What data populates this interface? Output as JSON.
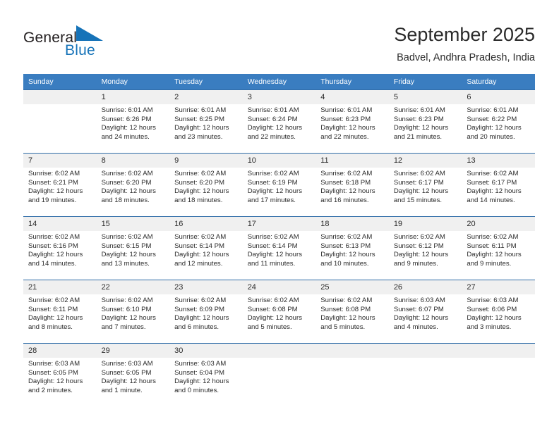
{
  "brand": {
    "name_part1": "General",
    "name_part2": "Blue",
    "triangle_color": "#1673b8"
  },
  "header": {
    "title": "September 2025",
    "subtitle": "Badvel, Andhra Pradesh, India"
  },
  "theme": {
    "header_bg": "#3a7dc0",
    "row_border": "#2f6ca8",
    "daynum_bg": "#f0f0f0",
    "text": "#2b2b2b"
  },
  "weekdays": [
    "Sunday",
    "Monday",
    "Tuesday",
    "Wednesday",
    "Thursday",
    "Friday",
    "Saturday"
  ],
  "weeks": [
    [
      {
        "day": "",
        "lines": []
      },
      {
        "day": "1",
        "lines": [
          "Sunrise: 6:01 AM",
          "Sunset: 6:26 PM",
          "Daylight: 12 hours",
          "and 24 minutes."
        ]
      },
      {
        "day": "2",
        "lines": [
          "Sunrise: 6:01 AM",
          "Sunset: 6:25 PM",
          "Daylight: 12 hours",
          "and 23 minutes."
        ]
      },
      {
        "day": "3",
        "lines": [
          "Sunrise: 6:01 AM",
          "Sunset: 6:24 PM",
          "Daylight: 12 hours",
          "and 22 minutes."
        ]
      },
      {
        "day": "4",
        "lines": [
          "Sunrise: 6:01 AM",
          "Sunset: 6:23 PM",
          "Daylight: 12 hours",
          "and 22 minutes."
        ]
      },
      {
        "day": "5",
        "lines": [
          "Sunrise: 6:01 AM",
          "Sunset: 6:23 PM",
          "Daylight: 12 hours",
          "and 21 minutes."
        ]
      },
      {
        "day": "6",
        "lines": [
          "Sunrise: 6:01 AM",
          "Sunset: 6:22 PM",
          "Daylight: 12 hours",
          "and 20 minutes."
        ]
      }
    ],
    [
      {
        "day": "7",
        "lines": [
          "Sunrise: 6:02 AM",
          "Sunset: 6:21 PM",
          "Daylight: 12 hours",
          "and 19 minutes."
        ]
      },
      {
        "day": "8",
        "lines": [
          "Sunrise: 6:02 AM",
          "Sunset: 6:20 PM",
          "Daylight: 12 hours",
          "and 18 minutes."
        ]
      },
      {
        "day": "9",
        "lines": [
          "Sunrise: 6:02 AM",
          "Sunset: 6:20 PM",
          "Daylight: 12 hours",
          "and 18 minutes."
        ]
      },
      {
        "day": "10",
        "lines": [
          "Sunrise: 6:02 AM",
          "Sunset: 6:19 PM",
          "Daylight: 12 hours",
          "and 17 minutes."
        ]
      },
      {
        "day": "11",
        "lines": [
          "Sunrise: 6:02 AM",
          "Sunset: 6:18 PM",
          "Daylight: 12 hours",
          "and 16 minutes."
        ]
      },
      {
        "day": "12",
        "lines": [
          "Sunrise: 6:02 AM",
          "Sunset: 6:17 PM",
          "Daylight: 12 hours",
          "and 15 minutes."
        ]
      },
      {
        "day": "13",
        "lines": [
          "Sunrise: 6:02 AM",
          "Sunset: 6:17 PM",
          "Daylight: 12 hours",
          "and 14 minutes."
        ]
      }
    ],
    [
      {
        "day": "14",
        "lines": [
          "Sunrise: 6:02 AM",
          "Sunset: 6:16 PM",
          "Daylight: 12 hours",
          "and 14 minutes."
        ]
      },
      {
        "day": "15",
        "lines": [
          "Sunrise: 6:02 AM",
          "Sunset: 6:15 PM",
          "Daylight: 12 hours",
          "and 13 minutes."
        ]
      },
      {
        "day": "16",
        "lines": [
          "Sunrise: 6:02 AM",
          "Sunset: 6:14 PM",
          "Daylight: 12 hours",
          "and 12 minutes."
        ]
      },
      {
        "day": "17",
        "lines": [
          "Sunrise: 6:02 AM",
          "Sunset: 6:14 PM",
          "Daylight: 12 hours",
          "and 11 minutes."
        ]
      },
      {
        "day": "18",
        "lines": [
          "Sunrise: 6:02 AM",
          "Sunset: 6:13 PM",
          "Daylight: 12 hours",
          "and 10 minutes."
        ]
      },
      {
        "day": "19",
        "lines": [
          "Sunrise: 6:02 AM",
          "Sunset: 6:12 PM",
          "Daylight: 12 hours",
          "and 9 minutes."
        ]
      },
      {
        "day": "20",
        "lines": [
          "Sunrise: 6:02 AM",
          "Sunset: 6:11 PM",
          "Daylight: 12 hours",
          "and 9 minutes."
        ]
      }
    ],
    [
      {
        "day": "21",
        "lines": [
          "Sunrise: 6:02 AM",
          "Sunset: 6:11 PM",
          "Daylight: 12 hours",
          "and 8 minutes."
        ]
      },
      {
        "day": "22",
        "lines": [
          "Sunrise: 6:02 AM",
          "Sunset: 6:10 PM",
          "Daylight: 12 hours",
          "and 7 minutes."
        ]
      },
      {
        "day": "23",
        "lines": [
          "Sunrise: 6:02 AM",
          "Sunset: 6:09 PM",
          "Daylight: 12 hours",
          "and 6 minutes."
        ]
      },
      {
        "day": "24",
        "lines": [
          "Sunrise: 6:02 AM",
          "Sunset: 6:08 PM",
          "Daylight: 12 hours",
          "and 5 minutes."
        ]
      },
      {
        "day": "25",
        "lines": [
          "Sunrise: 6:02 AM",
          "Sunset: 6:08 PM",
          "Daylight: 12 hours",
          "and 5 minutes."
        ]
      },
      {
        "day": "26",
        "lines": [
          "Sunrise: 6:03 AM",
          "Sunset: 6:07 PM",
          "Daylight: 12 hours",
          "and 4 minutes."
        ]
      },
      {
        "day": "27",
        "lines": [
          "Sunrise: 6:03 AM",
          "Sunset: 6:06 PM",
          "Daylight: 12 hours",
          "and 3 minutes."
        ]
      }
    ],
    [
      {
        "day": "28",
        "lines": [
          "Sunrise: 6:03 AM",
          "Sunset: 6:05 PM",
          "Daylight: 12 hours",
          "and 2 minutes."
        ]
      },
      {
        "day": "29",
        "lines": [
          "Sunrise: 6:03 AM",
          "Sunset: 6:05 PM",
          "Daylight: 12 hours",
          "and 1 minute."
        ]
      },
      {
        "day": "30",
        "lines": [
          "Sunrise: 6:03 AM",
          "Sunset: 6:04 PM",
          "Daylight: 12 hours",
          "and 0 minutes."
        ]
      },
      {
        "day": "",
        "lines": []
      },
      {
        "day": "",
        "lines": []
      },
      {
        "day": "",
        "lines": []
      },
      {
        "day": "",
        "lines": []
      }
    ]
  ]
}
